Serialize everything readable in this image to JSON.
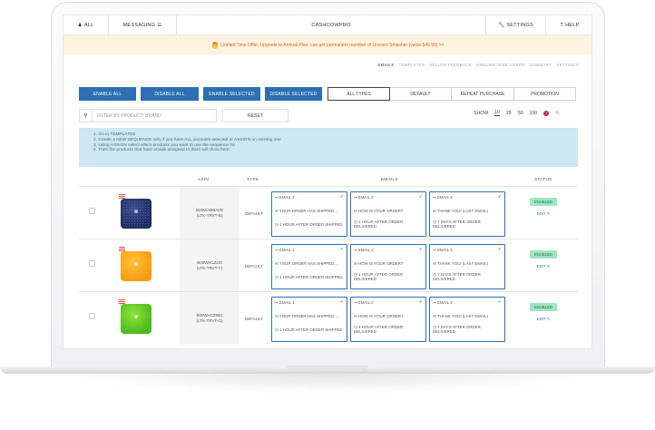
{
  "nav": {
    "all": "ALL",
    "messaging": "MESSAGING",
    "brand": "CASHCOWPRO",
    "settings": "SETTINGS",
    "help": "HELP"
  },
  "promo": "Limited Time Offer, Upgrade to Annual Plan, can get permanent member of Unicorn Smasher (value $49.99) >>",
  "subtabs": [
    "EMAILS",
    "TEMPLATES",
    "SELLER FEEDBACK",
    "UNSUBSCRIBE USERS",
    "SUMMARY",
    "SETTINGS"
  ],
  "actions": [
    "ENABLE ALL",
    "DISABLE ALL",
    "ENABLE SELECTED",
    "DISABLE SELECTED"
  ],
  "types": [
    "ALL TYPES",
    "DEFAULT",
    "REPEAT PURCHASE",
    "PROMOTION"
  ],
  "search": {
    "placeholder": "FILTER BY PRODUCT, BRAND"
  },
  "reset": "RESET",
  "show": {
    "label": "SHOW",
    "options": [
      "10",
      "25",
      "50",
      "100"
    ],
    "selected": "10",
    "percent": "%"
  },
  "info": [
    "1. Go to TEMPLATES",
    "2. Create a NEW SEQUENCE only if you have ALL accounts selected or ASSIGN an existing one",
    "3. Using ASSIGN select which products you want to use the sequence for",
    "4. Then the products that have emails assigned to them will show here."
  ],
  "columns": {
    "asin": "ASIN",
    "type": "TYPE",
    "emails": "EMAILS",
    "status": "STATUS"
  },
  "rows": [
    {
      "asin": "B00WABBAVB",
      "sku": "(LTK-TRVT-B)",
      "type": "DEFAULT",
      "emails": [
        {
          "title": "EMAIL 1",
          "subject": "YOUR ORDER HAS SHIPPED...",
          "timing": "1 HOUR AFTER ORDER SHIPPED"
        },
        {
          "title": "EMAIL 2",
          "subject": "HOW IS YOUR ORDER?",
          "timing": "1 HOUR AFTER ORDER DELIVERED"
        },
        {
          "title": "EMAIL 3",
          "subject": "THANK YOU! (LAST EMAIL)",
          "timing": "7 DAYS AFTER ORDER DELIVERED"
        }
      ],
      "status": "ENABLED",
      "edit": "EDIT"
    },
    {
      "asin": "B00WACZ2ZI",
      "sku": "(LTK-TRVT-Y)",
      "type": "DEFAULT",
      "emails": [
        {
          "title": "EMAIL 1",
          "subject": "YOUR ORDER HAS SHIPPED...",
          "timing": "1 HOUR AFTER ORDER SHIPPED"
        },
        {
          "title": "EMAIL 2",
          "subject": "HOW IS YOUR ORDER?",
          "timing": "1 HOUR AFTER ORDER DELIVERED"
        },
        {
          "title": "EMAIL 3",
          "subject": "THANK YOU! (LAST EMAIL)",
          "timing": "7 DAYS AFTER ORDER DELIVERED"
        }
      ],
      "status": "ENABLED",
      "edit": "EDIT"
    },
    {
      "asin": "B00WACZ9B1",
      "sku": "(LTK-TRVT-G)",
      "type": "DEFAULT",
      "emails": [
        {
          "title": "EMAIL 1",
          "subject": "YOUR ORDER HAS SHIPPED...",
          "timing": "1 HOUR AFTER ORDER SHIPPED"
        },
        {
          "title": "EMAIL 2",
          "subject": "HOW IS YOUR ORDER?",
          "timing": "1 HOUR AFTER ORDER DELIVERED"
        },
        {
          "title": "EMAIL 3",
          "subject": "THANK YOU! (LAST EMAIL)",
          "timing": "7 DAYS AFTER ORDER DELIVERED"
        }
      ],
      "status": "ENABLED",
      "edit": "EDIT"
    }
  ],
  "colors": {
    "primary": "#2d6fb2",
    "info_bg": "#cde7f3",
    "promo_bg": "#fdf3e1",
    "promo_text": "#d9661f",
    "badge": "#9be7c2"
  },
  "icons": [
    "user-icon",
    "menu-icon",
    "wrench-icon",
    "help-icon",
    "flame-icon",
    "search-icon",
    "question-icon",
    "arrow-icon",
    "envelope-icon",
    "clock-icon",
    "check-icon",
    "edit-icon",
    "flag-icon"
  ]
}
